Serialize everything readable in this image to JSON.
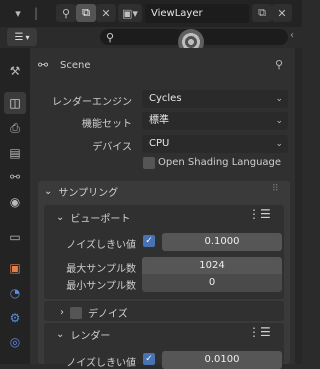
{
  "header": {
    "view_layer": "ViewLayer",
    "icons": [
      "pin-icon",
      "copy-icon",
      "close-icon",
      "view-layer-icon",
      "copy-icon",
      "close-icon"
    ]
  },
  "toolbar": {
    "search_placeholder": ""
  },
  "tabs": [
    "tool",
    "render",
    "output",
    "view-layer",
    "scene",
    "world",
    "collection",
    "object",
    "modifiers",
    "particles",
    "physics",
    "constraints"
  ],
  "context": {
    "label": "Scene"
  },
  "properties": {
    "render_engine": {
      "label": "レンダーエンジン",
      "value": "Cycles"
    },
    "feature_set": {
      "label": "機能セット",
      "value": "標準"
    },
    "device": {
      "label": "デバイス",
      "value": "CPU"
    },
    "osl": {
      "label": "Open Shading Language",
      "checked": false
    }
  },
  "sampling": {
    "title": "サンプリング",
    "viewport": {
      "title": "ビューポート",
      "noise_threshold": {
        "label": "ノイズしきい値",
        "checked": true,
        "value": "0.1000"
      },
      "max_samples": {
        "label": "最大サンプル数",
        "value": "1024"
      },
      "min_samples": {
        "label": "最小サンプル数",
        "value": "0"
      },
      "denoise": {
        "label": "デノイズ",
        "checked": false
      }
    },
    "render": {
      "title": "レンダー",
      "noise_threshold": {
        "label": "ノイズしきい値",
        "checked": true,
        "value": "0.0100"
      }
    }
  }
}
